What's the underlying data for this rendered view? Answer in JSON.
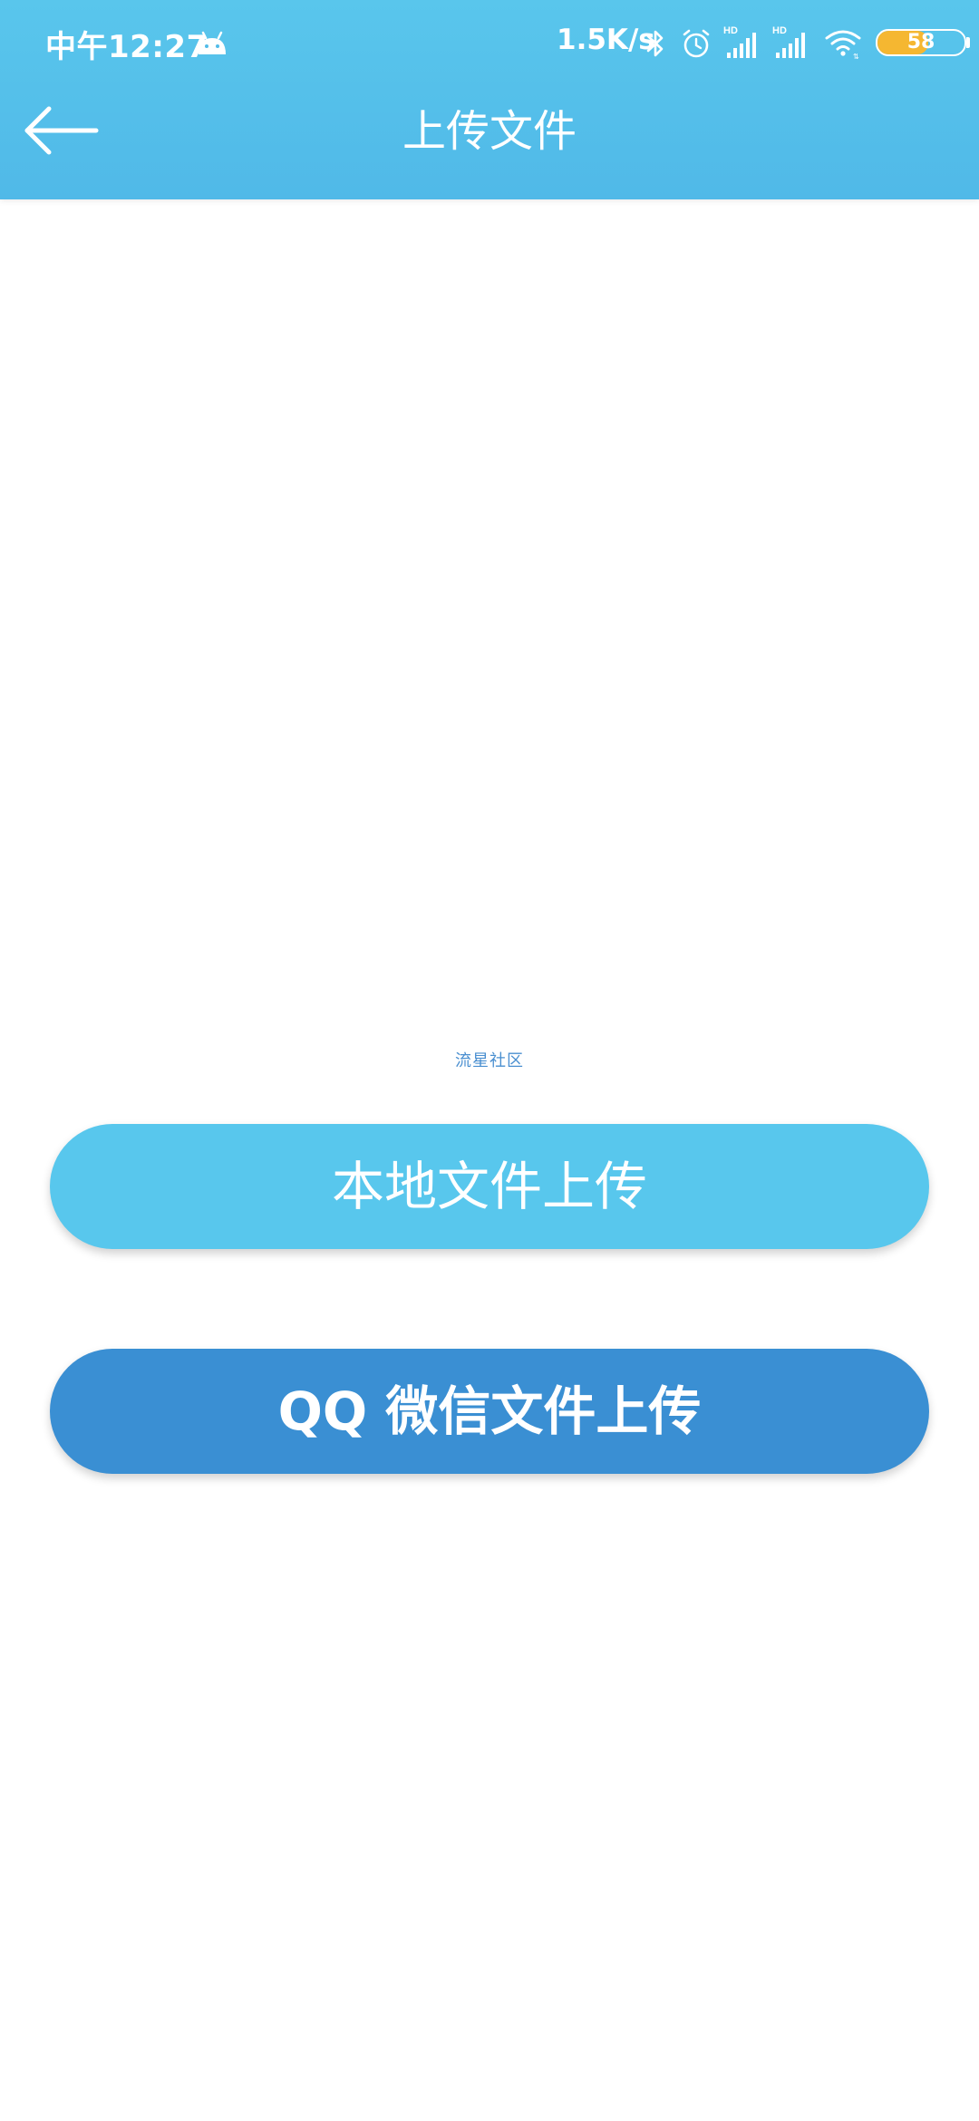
{
  "status_bar": {
    "time": "中午12:27",
    "net_speed": "1.5K/s",
    "battery_level": "58",
    "battery_fraction": 0.58,
    "icons": [
      "android-icon",
      "bluetooth-icon",
      "alarm-icon",
      "hd-signal-icon",
      "hd-signal-icon",
      "wifi-icon",
      "battery-icon"
    ]
  },
  "app_bar": {
    "title": "上传文件",
    "back_icon": "arrow-left-icon"
  },
  "watermark": "流星社区",
  "buttons": {
    "local_upload": "本地文件上传",
    "qq_wechat_upload": "QQ 微信文件上传"
  },
  "colors": {
    "header": "#55c0ea",
    "local_button": "#58c7ed",
    "qq_button": "#3a8fd3",
    "battery_fill": "#f5b731"
  }
}
